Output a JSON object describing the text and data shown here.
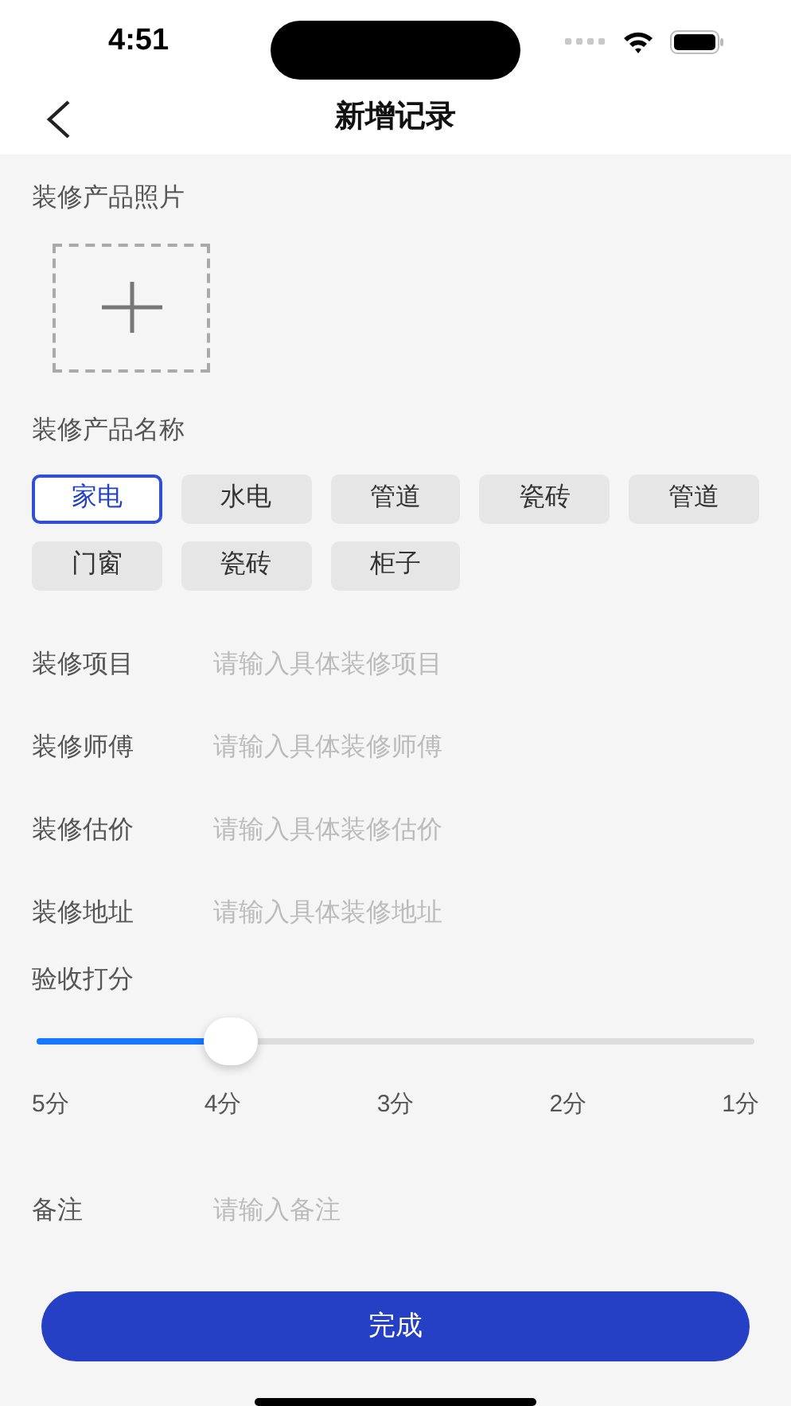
{
  "status_bar": {
    "time": "4:51"
  },
  "nav": {
    "title": "新增记录"
  },
  "photo_section": {
    "label": "装修产品照片"
  },
  "product_section": {
    "label": "装修产品名称",
    "chips": [
      {
        "label": "家电",
        "selected": true
      },
      {
        "label": "水电",
        "selected": false
      },
      {
        "label": "管道",
        "selected": false
      },
      {
        "label": "瓷砖",
        "selected": false
      },
      {
        "label": "管道",
        "selected": false
      },
      {
        "label": "门窗",
        "selected": false
      },
      {
        "label": "瓷砖",
        "selected": false
      },
      {
        "label": "柜子",
        "selected": false
      }
    ]
  },
  "fields": [
    {
      "label": "装修项目",
      "placeholder": "请输入具体装修项目"
    },
    {
      "label": "装修师傅",
      "placeholder": "请输入具体装修师傅"
    },
    {
      "label": "装修估价",
      "placeholder": "请输入具体装修估价"
    },
    {
      "label": "装修地址",
      "placeholder": "请输入具体装修地址"
    }
  ],
  "rating": {
    "label": "验收打分",
    "level": 0.27,
    "ticks": [
      "5分",
      "4分",
      "3分",
      "2分",
      "1分"
    ]
  },
  "note": {
    "label": "备注",
    "placeholder": "请输入备注"
  },
  "submit": "完成"
}
